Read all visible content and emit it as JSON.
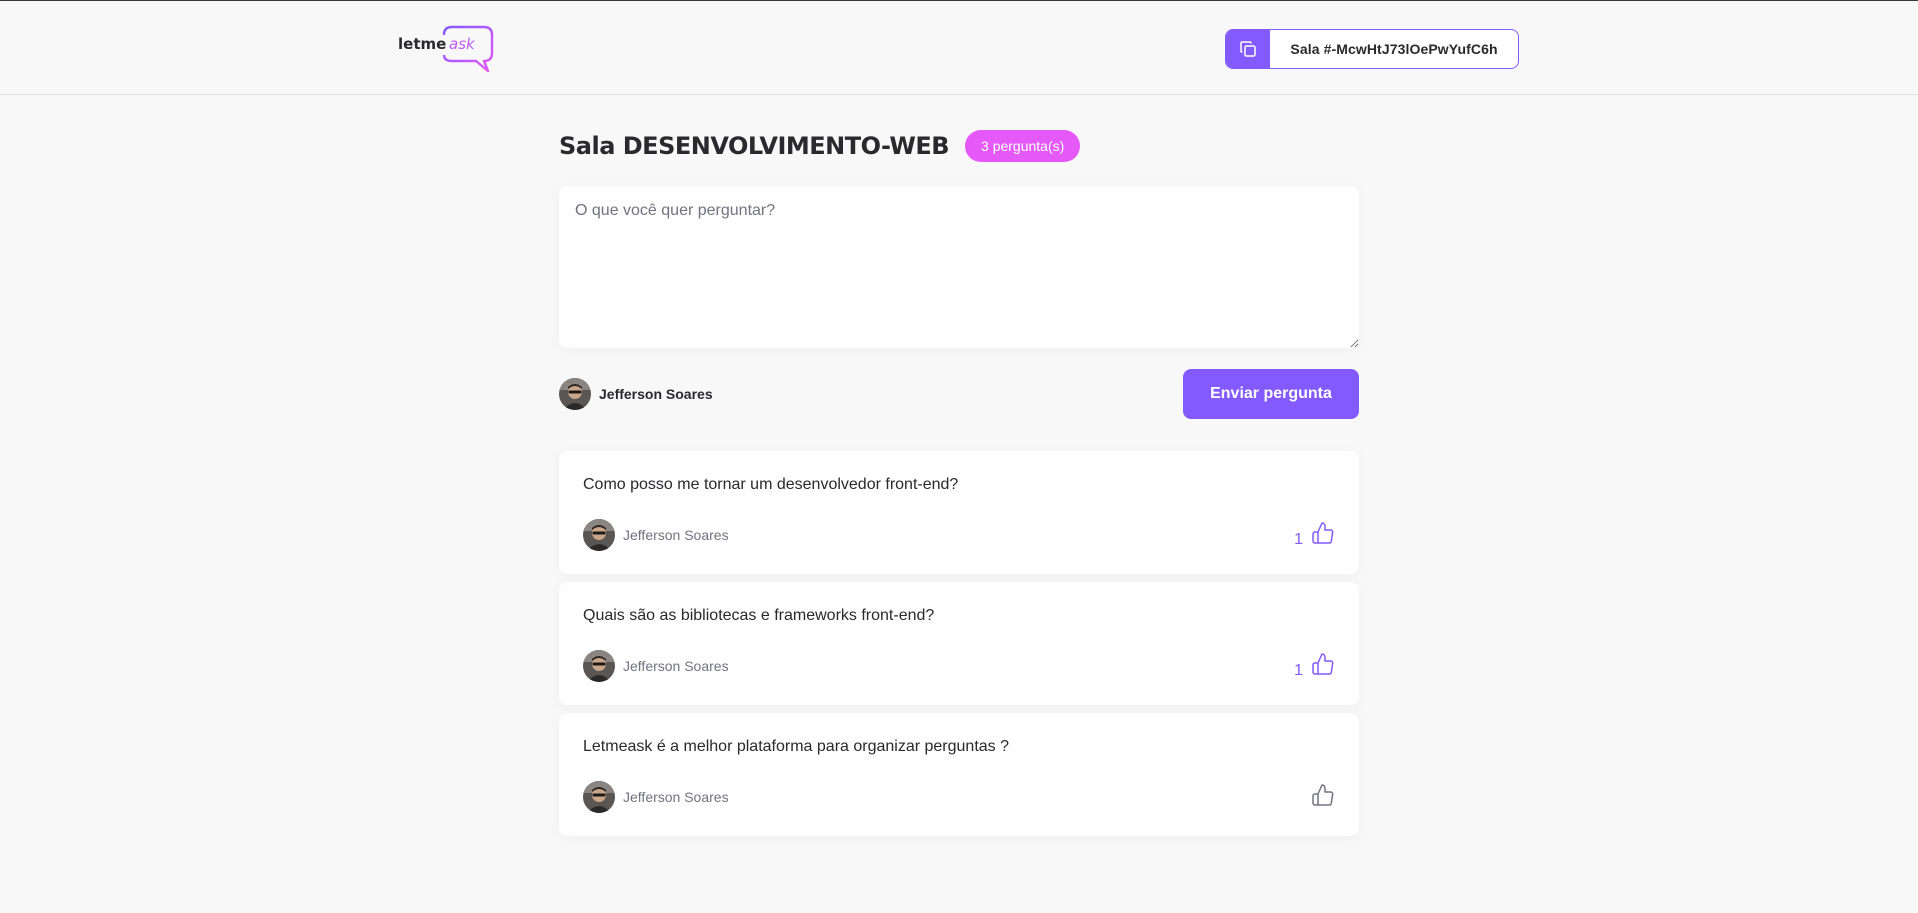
{
  "header": {
    "logo": {
      "text_left": "letme",
      "text_right": "ask"
    },
    "room_code": {
      "label": "Sala #-McwHtJ73lOePwYufC6h",
      "icon": "copy-icon"
    }
  },
  "colors": {
    "accent": "#835afd",
    "badge": "#e559f9",
    "background": "#f8f8f8",
    "text": "#29292e",
    "muted": "#737380"
  },
  "room": {
    "title": "Sala DESENVOLVIMENTO-WEB",
    "badge": "3 pergunta(s)"
  },
  "form": {
    "placeholder": "O que você quer perguntar?",
    "value": "",
    "user_name": "Jefferson Soares",
    "submit_label": "Enviar pergunta"
  },
  "questions": [
    {
      "content": "Como posso me tornar um desenvolvedor front-end?",
      "author": "Jefferson Soares",
      "like_count": "1",
      "icon": "thumbs-up-icon"
    },
    {
      "content": "Quais são as bibliotecas e frameworks front-end?",
      "author": "Jefferson Soares",
      "like_count": "1",
      "icon": "thumbs-up-icon"
    },
    {
      "content": "Letmeask é a melhor plataforma para organizar perguntas ?",
      "author": "Jefferson Soares",
      "like_count": "",
      "icon": "thumbs-up-icon"
    }
  ]
}
